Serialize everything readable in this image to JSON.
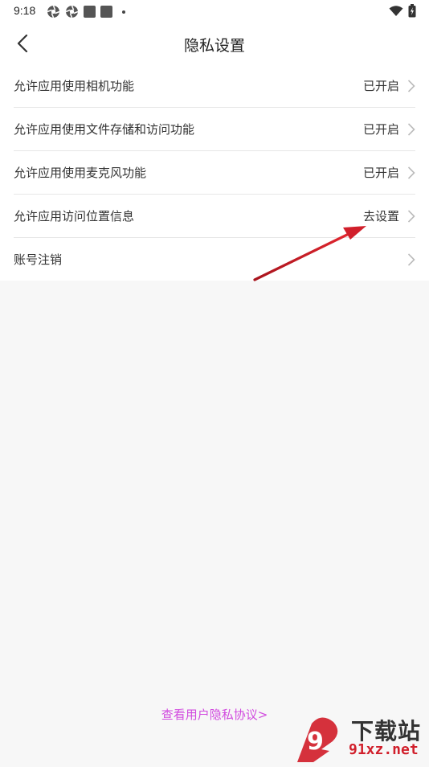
{
  "status_bar": {
    "time": "9:18"
  },
  "header": {
    "title": "隐私设置"
  },
  "settings": {
    "items": [
      {
        "label": "允许应用使用相机功能",
        "value": "已开启"
      },
      {
        "label": "允许应用使用文件存储和访问功能",
        "value": "已开启"
      },
      {
        "label": "允许应用使用麦克风功能",
        "value": "已开启"
      },
      {
        "label": "允许应用访问位置信息",
        "value": "去设置"
      },
      {
        "label": "账号注销",
        "value": ""
      }
    ]
  },
  "footer": {
    "privacy_link": "查看用户隐私协议>"
  },
  "watermark": {
    "text": "下载站",
    "url": "91xz.net",
    "logo_glyph": "9"
  },
  "colors": {
    "link": "#d14bdf",
    "annotation_arrow": "#d11f2b"
  }
}
